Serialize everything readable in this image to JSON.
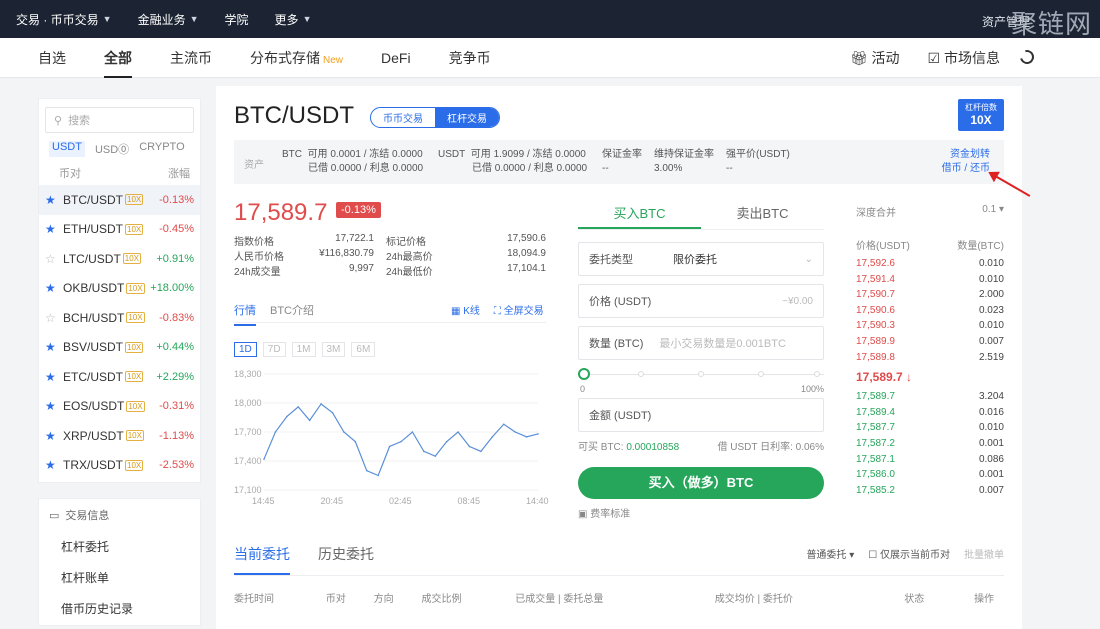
{
  "topbar": {
    "trade": "交易 · 币币交易",
    "finance": "金融业务",
    "academy": "学院",
    "more": "更多",
    "asset": "资产管理",
    "watermark": "聚链网"
  },
  "nav": {
    "tabs": [
      "自选",
      "全部",
      "主流币",
      "分布式存储",
      "DeFi",
      "竞争币"
    ],
    "new_badge": "New",
    "activity": "活动",
    "market": "市场信息"
  },
  "sidebar": {
    "search": "搜索",
    "filters": [
      "USDT",
      "USD⓪",
      "CRYPTO"
    ],
    "col_pair": "币对",
    "col_change": "涨幅",
    "rows": [
      {
        "pair": "BTC/USDT",
        "lev": "10X",
        "chg": "-0.13%",
        "dir": "neg",
        "star": true,
        "sel": true
      },
      {
        "pair": "ETH/USDT",
        "lev": "10X",
        "chg": "-0.45%",
        "dir": "neg",
        "star": true
      },
      {
        "pair": "LTC/USDT",
        "lev": "10X",
        "chg": "+0.91%",
        "dir": "pos",
        "star": false
      },
      {
        "pair": "OKB/USDT",
        "lev": "10X",
        "chg": "+18.00%",
        "dir": "pos",
        "star": true
      },
      {
        "pair": "BCH/USDT",
        "lev": "10X",
        "chg": "-0.83%",
        "dir": "neg",
        "star": false
      },
      {
        "pair": "BSV/USDT",
        "lev": "10X",
        "chg": "+0.44%",
        "dir": "pos",
        "star": true
      },
      {
        "pair": "ETC/USDT",
        "lev": "10X",
        "chg": "+2.29%",
        "dir": "pos",
        "star": true
      },
      {
        "pair": "EOS/USDT",
        "lev": "10X",
        "chg": "-0.31%",
        "dir": "neg",
        "star": true
      },
      {
        "pair": "XRP/USDT",
        "lev": "10X",
        "chg": "-1.13%",
        "dir": "neg",
        "star": true
      },
      {
        "pair": "TRX/USDT",
        "lev": "10X",
        "chg": "-2.53%",
        "dir": "neg",
        "star": true
      }
    ]
  },
  "sidebar2": {
    "title": "交易信息",
    "items": [
      "杠杆委托",
      "杠杆账单",
      "借币历史记录"
    ]
  },
  "header": {
    "pair": "BTC/USDT",
    "mode_spot": "币币交易",
    "mode_margin": "杠杆交易",
    "lev_label": "杠杆倍数",
    "lev_value": "10X"
  },
  "assets": {
    "label": "资产",
    "btc": {
      "name": "BTC",
      "line1": "可用 0.0001 / 冻结 0.0000",
      "line2": "已借 0.0000 / 利息 0.0000"
    },
    "usdt": {
      "name": "USDT",
      "line1": "可用 1.9099 / 冻结 0.0000",
      "line2": "已借 0.0000 / 利息 0.0000"
    },
    "margin_ratio": "保证金率",
    "margin_ratio_v": "--",
    "maint": "维持保证金率",
    "maint_v": "3.00%",
    "liq": "强平价(USDT)",
    "liq_v": "--",
    "transfer": "资金划转",
    "borrow": "借币 / 还币"
  },
  "ticker": {
    "price": "17,589.7",
    "change": "-0.13%",
    "stats": [
      [
        "指数价格",
        "17,722.1",
        "标记价格",
        "17,590.6"
      ],
      [
        "人民币价格",
        "¥116,830.79",
        "24h最高价",
        "18,094.9"
      ],
      [
        "24h成交量",
        "9,997",
        "24h最低价",
        "17,104.1"
      ]
    ]
  },
  "chart_tabs": {
    "market": "行情",
    "intro": "BTC介绍",
    "kline": "K线",
    "full": "全屏交易",
    "ranges": [
      "1D",
      "7D",
      "1M",
      "3M",
      "6M"
    ]
  },
  "chart_data": {
    "type": "line",
    "x": [
      "14:45",
      "20:45",
      "02:45",
      "08:45",
      "14:40"
    ],
    "ylim": [
      17100,
      18300
    ],
    "yticks": [
      18300,
      18000,
      17700,
      17400,
      17100
    ],
    "values": [
      17420,
      17700,
      17860,
      17960,
      17820,
      17990,
      17900,
      17700,
      17600,
      17300,
      17250,
      17550,
      17600,
      17700,
      17500,
      17450,
      17600,
      17700,
      17550,
      17500,
      17650,
      17780,
      17700,
      17650,
      17680
    ]
  },
  "trade": {
    "buy_tab": "买入BTC",
    "sell_tab": "卖出BTC",
    "order_type_label": "委托类型",
    "order_type": "限价委托",
    "price_label": "价格 (USDT)",
    "price_ph": "~¥0.00",
    "amount_label": "数量 (BTC)",
    "amount_ph": "最小交易数量是0.001BTC",
    "pct0": "0",
    "pct100": "100%",
    "total_label": "金额 (USDT)",
    "avail": "可买 BTC:",
    "avail_v": "0.00010858",
    "rate": "借 USDT 日利率: 0.06%",
    "buy_btn": "买入（做多）BTC",
    "fee": "费率标准"
  },
  "orderbook": {
    "depth": "深度合并",
    "depth_v": "0.1",
    "col_price": "价格(USDT)",
    "col_amt": "数量(BTC)",
    "asks": [
      [
        "17,592.6",
        "0.010"
      ],
      [
        "17,591.4",
        "0.010"
      ],
      [
        "17,590.7",
        "2.000"
      ],
      [
        "17,590.6",
        "0.023"
      ],
      [
        "17,590.3",
        "0.010"
      ],
      [
        "17,589.9",
        "0.007"
      ],
      [
        "17,589.8",
        "2.519"
      ]
    ],
    "last": "17,589.7 ↓",
    "bids": [
      [
        "17,589.7",
        "3.204"
      ],
      [
        "17,589.4",
        "0.016"
      ],
      [
        "17,587.7",
        "0.010"
      ],
      [
        "17,587.2",
        "0.001"
      ],
      [
        "17,587.1",
        "0.086"
      ],
      [
        "17,586.0",
        "0.001"
      ],
      [
        "17,585.2",
        "0.007"
      ]
    ]
  },
  "orders": {
    "current": "当前委托",
    "history": "历史委托",
    "filter": "普通委托",
    "only_current": "仅展示当前币对",
    "cancel_all": "批量撤单",
    "cols": [
      "委托时间",
      "币对",
      "方向",
      "成交比例",
      "已成交量 | 委托总量",
      "成交均价 | 委托价",
      "状态",
      "操作"
    ]
  }
}
